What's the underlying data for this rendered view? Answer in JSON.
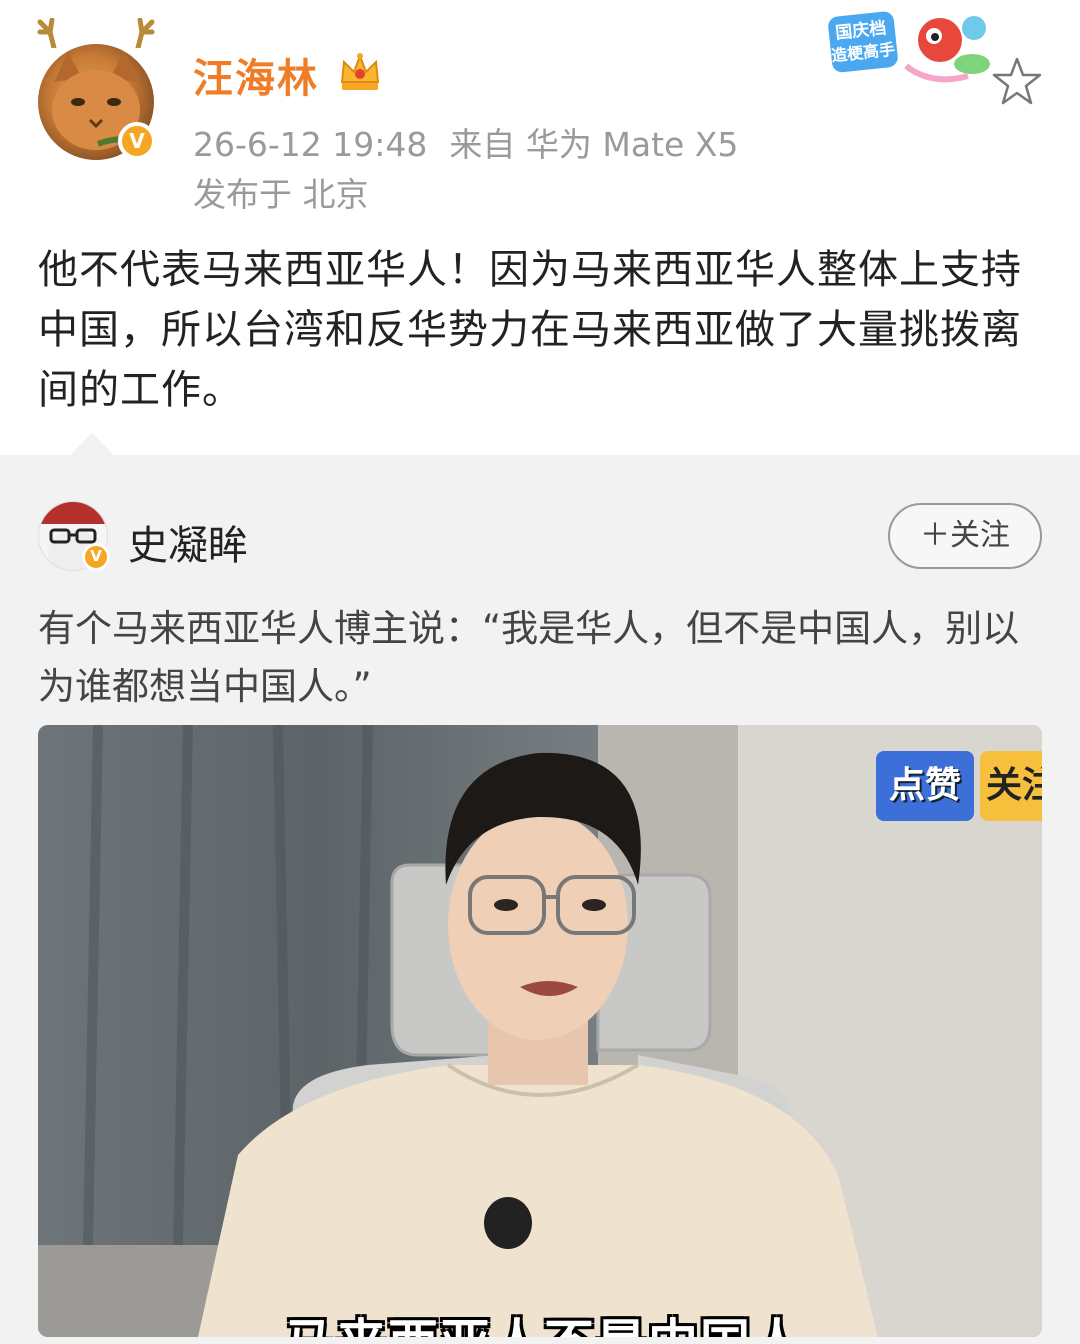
{
  "post": {
    "username": "汪海林",
    "timestamp": "26-6-12 19:48",
    "source": "来自 华为 Mate X5",
    "location": "发布于 北京",
    "verified_badge": "V",
    "content": "他不代表马来西亚华人！因为马来西亚华人整体上支持中国，所以台湾和反华势力在马来西亚做了大量挑拨离间的工作。",
    "promo_badge_text": [
      "国庆档",
      "造梗高手"
    ],
    "icons": [
      "crown-icon",
      "star-icon"
    ]
  },
  "repost": {
    "username": "史凝眸",
    "verified_badge": "V",
    "follow_label": "＋关注",
    "content": "有个马来西亚华人博主说：“我是华人，但不是中国人，别以为谁都想当中国人。”",
    "video": {
      "sticker_like": "点赞",
      "sticker_follow": "关注",
      "subtitle": "马来西亚人不是中国人"
    }
  },
  "colors": {
    "username_accent": "#f07c28",
    "meta_gray": "#9a9a9a",
    "badge_orange": "#f5a623",
    "repost_bg": "#f2f2f2"
  }
}
